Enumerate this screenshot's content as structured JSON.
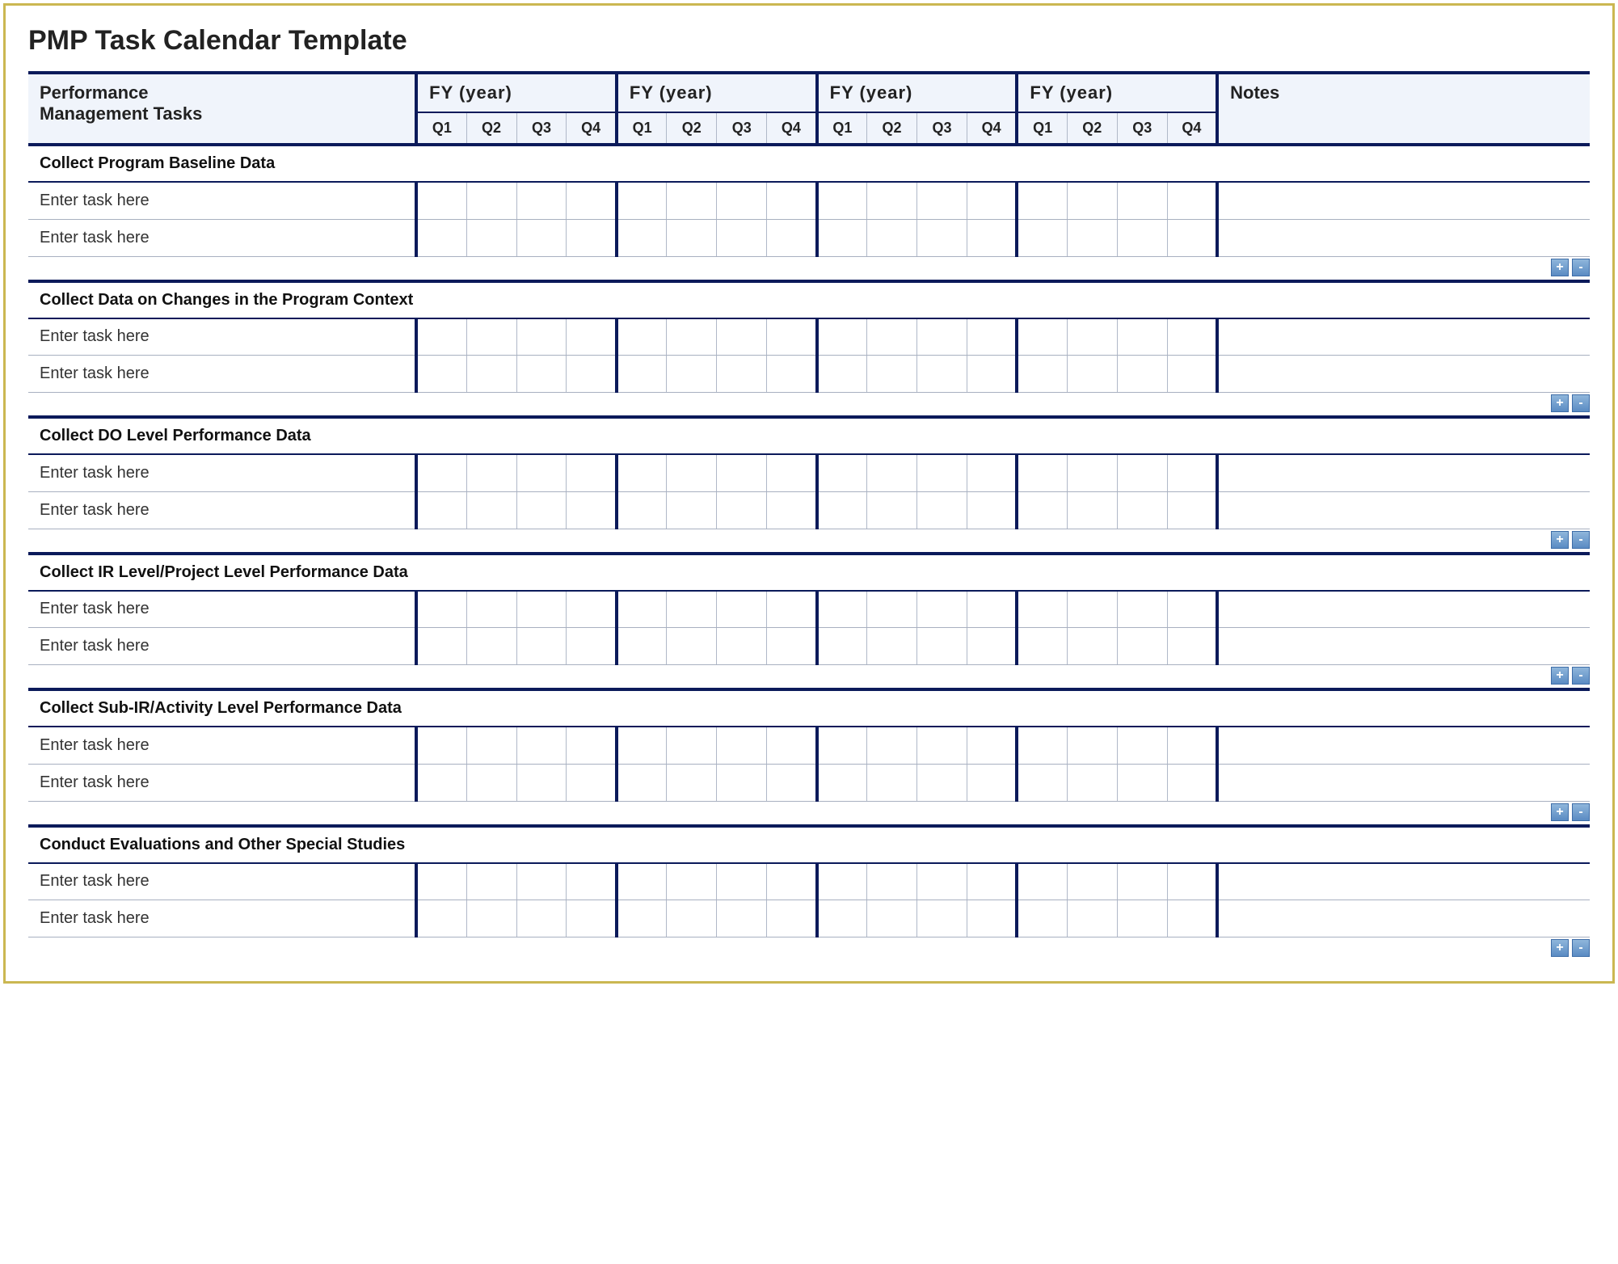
{
  "title": "PMP Task Calendar Template",
  "header": {
    "tasks": "Performance Management Tasks",
    "fy_label": "FY  (year)",
    "quarters": [
      "Q1",
      "Q2",
      "Q3",
      "Q4"
    ],
    "notes": "Notes"
  },
  "task_placeholder": "Enter task here",
  "controls": {
    "add": "+",
    "remove": "-"
  },
  "sections": [
    {
      "heading": "Collect Program Baseline Data",
      "task_rows": 2,
      "has_controls": true
    },
    {
      "heading": "Collect Data on Changes in the Program Context",
      "task_rows": 2,
      "has_controls": true
    },
    {
      "heading": "Collect DO Level Performance Data",
      "task_rows": 2,
      "has_controls": true
    },
    {
      "heading": "Collect IR Level/Project Level Performance Data",
      "task_rows": 2,
      "has_controls": true
    },
    {
      "heading": "Collect Sub-IR/Activity Level Performance Data",
      "task_rows": 2,
      "has_controls": true
    },
    {
      "heading": "Conduct Evaluations and Other Special Studies",
      "task_rows": 2,
      "has_controls": true
    }
  ],
  "year_count": 4
}
